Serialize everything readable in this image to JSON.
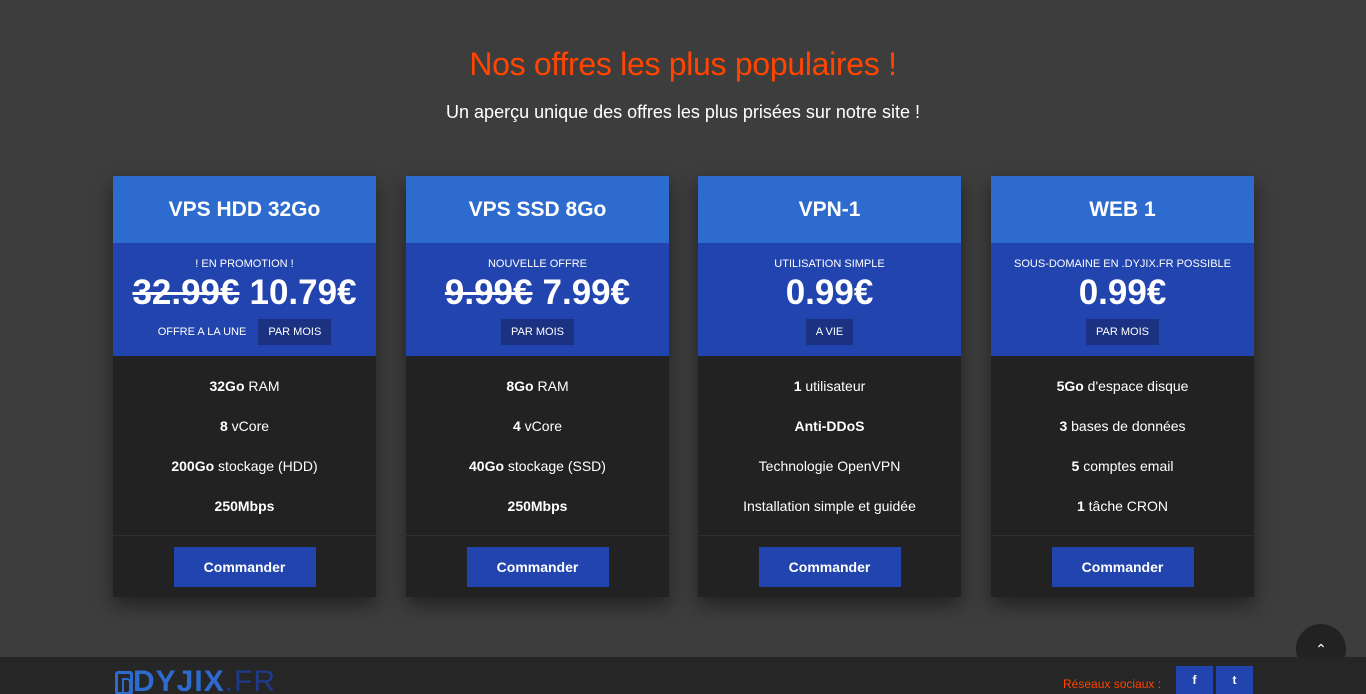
{
  "header": {
    "title": "Nos offres les plus populaires !",
    "subtitle": "Un aperçu unique des offres les plus prisées sur notre site !"
  },
  "plans": [
    {
      "name": "VPS HDD 32Go",
      "note": "! EN PROMOTION !",
      "old_price": "32.99€",
      "price": "10.79€",
      "extra_tag": "OFFRE A LA UNE",
      "period": "PAR MOIS",
      "features": [
        {
          "bold": "32Go",
          "text": " RAM"
        },
        {
          "bold": "8",
          "text": " vCore"
        },
        {
          "bold": "200Go",
          "text": " stockage (HDD)"
        },
        {
          "bold": "250Mbps",
          "text": ""
        }
      ],
      "button": "Commander"
    },
    {
      "name": "VPS SSD 8Go",
      "note": "NOUVELLE OFFRE",
      "old_price": "9.99€",
      "price": "7.99€",
      "extra_tag": "",
      "period": "PAR MOIS",
      "features": [
        {
          "bold": "8Go",
          "text": " RAM"
        },
        {
          "bold": "4",
          "text": " vCore"
        },
        {
          "bold": "40Go",
          "text": " stockage (SSD)"
        },
        {
          "bold": "250Mbps",
          "text": ""
        }
      ],
      "button": "Commander"
    },
    {
      "name": "VPN-1",
      "note": "UTILISATION SIMPLE",
      "old_price": "",
      "price": "0.99€",
      "extra_tag": "",
      "period": "A VIE",
      "features": [
        {
          "bold": "1",
          "text": " utilisateur"
        },
        {
          "bold": "Anti-DDoS",
          "text": ""
        },
        {
          "bold": "",
          "text": "Technologie OpenVPN"
        },
        {
          "bold": "",
          "text": "Installation simple et guidée"
        }
      ],
      "button": "Commander"
    },
    {
      "name": "WEB 1",
      "note": "SOUS-DOMAINE EN .DYJIX.FR POSSIBLE",
      "old_price": "",
      "price": "0.99€",
      "extra_tag": "",
      "period": "PAR MOIS",
      "features": [
        {
          "bold": "5Go",
          "text": " d'espace disque"
        },
        {
          "bold": "3",
          "text": " bases de données"
        },
        {
          "bold": "5",
          "text": " comptes email"
        },
        {
          "bold": "1",
          "text": " tâche CRON"
        }
      ],
      "button": "Commander"
    }
  ],
  "scroll_top": {
    "icon": "chevron-up-icon",
    "glyph": "⌃"
  },
  "footer": {
    "logo_main": "DYJIX",
    "logo_tld": ".FR",
    "social_label": "Réseaux sociaux :",
    "social": [
      {
        "icon": "facebook-icon",
        "glyph": "f"
      },
      {
        "icon": "twitter-icon",
        "glyph": "t"
      }
    ]
  },
  "colors": {
    "background": "#3d3d3d",
    "title_accent": "#ff4500",
    "card_header": "#2e6bcf",
    "card_price": "#2244ae",
    "card_body": "#222222",
    "button": "#2244ae"
  }
}
